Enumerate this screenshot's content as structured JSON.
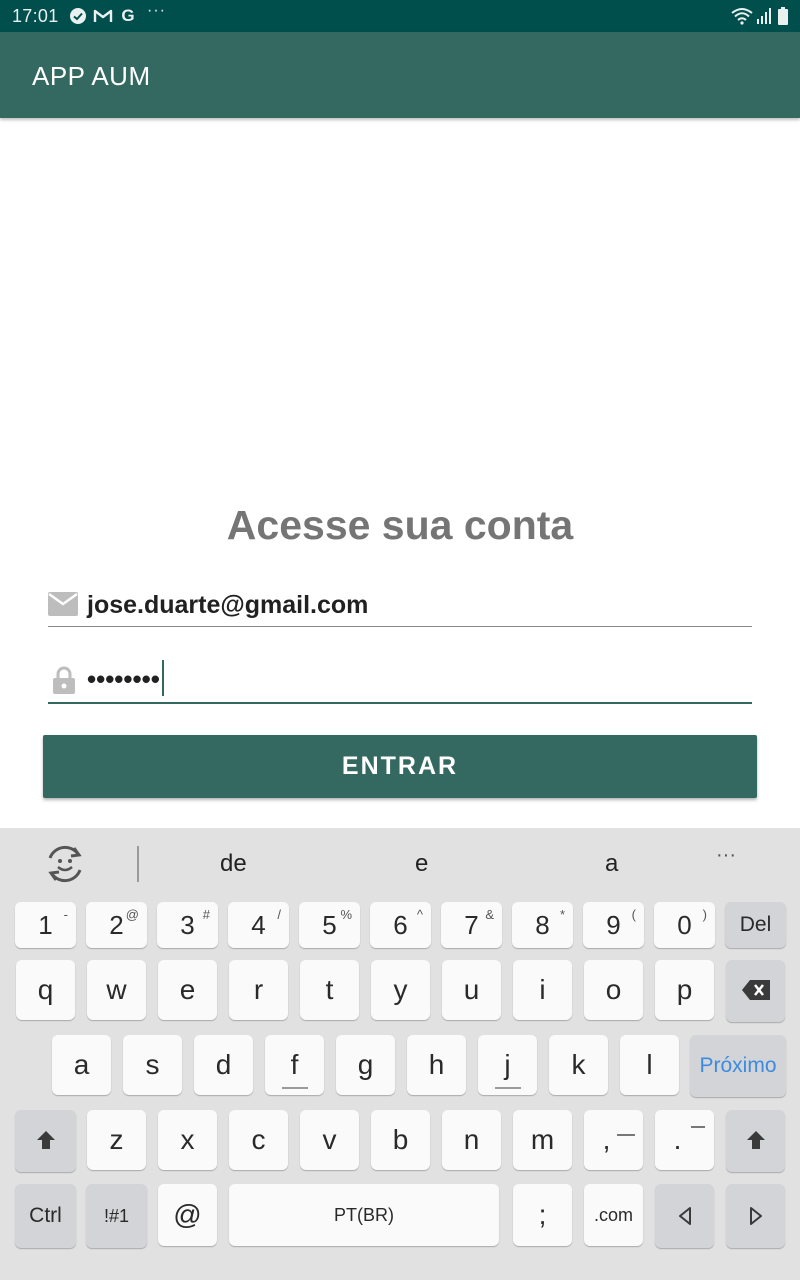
{
  "status_bar": {
    "time": "17:01",
    "more": "···",
    "icons": [
      "check-circle-icon",
      "gmail-icon",
      "google-icon",
      "wifi-icon",
      "signal-icon",
      "battery-icon"
    ]
  },
  "app_bar": {
    "title": "APP AUM"
  },
  "login": {
    "heading": "Acesse sua conta",
    "email_value": "jose.duarte@gmail.com",
    "password_value": "••••••••",
    "enter_button": "ENTRAR"
  },
  "keyboard": {
    "suggestions": [
      "de",
      "e",
      "a"
    ],
    "more": "···",
    "row_numbers": [
      {
        "main": "1",
        "sub": "-"
      },
      {
        "main": "2",
        "sub": "@"
      },
      {
        "main": "3",
        "sub": "#"
      },
      {
        "main": "4",
        "sub": "/"
      },
      {
        "main": "5",
        "sub": "%"
      },
      {
        "main": "6",
        "sub": "^"
      },
      {
        "main": "7",
        "sub": "&"
      },
      {
        "main": "8",
        "sub": "*"
      },
      {
        "main": "9",
        "sub": "("
      },
      {
        "main": "0",
        "sub": ")"
      }
    ],
    "del": "Del",
    "row1": [
      "q",
      "w",
      "e",
      "r",
      "t",
      "y",
      "u",
      "i",
      "o",
      "p"
    ],
    "row2": [
      "a",
      "s",
      "d",
      "f",
      "g",
      "h",
      "j",
      "k",
      "l"
    ],
    "next": "Próximo",
    "row3": [
      "z",
      "x",
      "c",
      "v",
      "b",
      "n",
      "m"
    ],
    "comma": ",",
    "period": ".",
    "ctrl": "Ctrl",
    "symbols": "!#1",
    "at": "@",
    "space": "PT(BR)",
    "semicolon": ";",
    "dotcom": ".com"
  },
  "colors": {
    "status_bar": "#004f4d",
    "primary": "#336960",
    "heading_text": "#757575",
    "keyboard_bg": "#e1e1e1",
    "next_key": "#3d8be0"
  }
}
